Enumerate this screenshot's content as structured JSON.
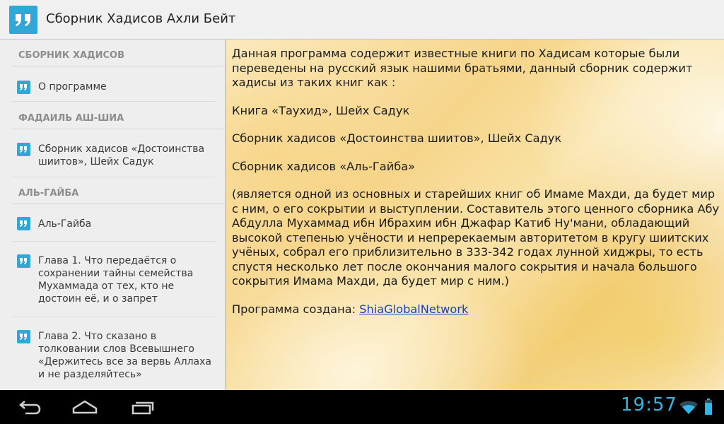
{
  "app": {
    "title": "Сборник Хадисов Ахли Бейт",
    "accent_color": "#33a6d8",
    "icon": "quote-icon"
  },
  "sidebar": {
    "sections": [
      {
        "header": "СБОРНИК ХАДИСОВ",
        "items": [
          {
            "label": "О программе"
          }
        ]
      },
      {
        "header": "ФАДАИЛЬ АШ-ШИА",
        "items": [
          {
            "label": "Сборник хадисов «Достоинства шиитов», Шейх Садук"
          }
        ]
      },
      {
        "header": "АЛЬ-ГАЙБА",
        "items": [
          {
            "label": "Аль-Гайба"
          },
          {
            "label": "Глава 1. Что передаётся о сохранении тайны семейства Мухаммада от тех, кто не достоин её, и о запрет"
          },
          {
            "label": "Глава 2. Что сказано в толковании слов Всевышнего «Держитесь все за вервь Аллаха и не разделяйтесь»"
          }
        ]
      }
    ]
  },
  "content": {
    "intro": "Данная программа содержит известные книги по Хадисам которые были переведены на русский язык нашими братьями, данный сборник содержит хадисы из таких книг как :",
    "book1": "Книга «Таухид»,  Шейх Садук",
    "book2": "Сборник хадисов «Достоинства шиитов»,  Шейх Садук",
    "book3": "Сборник хадисов «Аль-Гайба»",
    "description": "(является одной из основных и старейших книг об Имаме Махди, да будет мир с ним, о его сокрытии и выступлении. Составитель этого ценного сборника Абу Абдулла Мухаммад ибн Ибрахим ибн Джафар Катиб Ну'мани, обладающий высокой степенью учёности и непререкаемым авторитетом в кругу шиитских учёных, собрал его приблизительно в 333-342 годах лунной хиджры, то есть спустя несколько лет после окончания малого сокрытия и начала большого сокрытия Имама Махди, да будет мир с ним.)",
    "created_by_label": "Программа создана: ",
    "created_by_link": "ShiaGlobalNetwork"
  },
  "system_bar": {
    "time": "19:57",
    "icons": [
      "back-icon",
      "home-icon",
      "recent-apps-icon",
      "wifi-icon",
      "battery-icon"
    ]
  }
}
